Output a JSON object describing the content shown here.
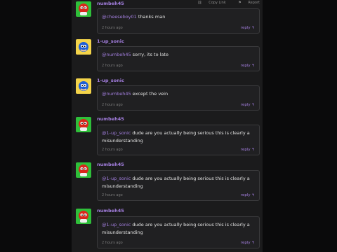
{
  "header_actions": {
    "copy_link": "Copy Link",
    "report": "Report"
  },
  "comments": [
    {
      "username": "numbeh45",
      "mention": "@cheeseboy01",
      "text": "thanks man",
      "time": "2 hours ago",
      "reply": "reply"
    },
    {
      "username": "1-up_sonic",
      "mention": "@numbeh45",
      "text": "sorry, its to late",
      "time": "2 hours ago",
      "reply": "reply"
    },
    {
      "username": "1-up_sonic",
      "mention": "@numbeh45",
      "text": "except the vein",
      "time": "2 hours ago",
      "reply": "reply"
    },
    {
      "username": "numbeh45",
      "mention": "@1-up_sonic",
      "text": "dude are you actually being serious this is clearly a misunderstanding",
      "time": "2 hours ago",
      "reply": "reply"
    },
    {
      "username": "numbeh45",
      "mention": "@1-up_sonic",
      "text": "dude are you actually being serious this is clearly a misunderstanding",
      "time": "2 hours ago",
      "reply": "reply"
    },
    {
      "username": "numbeh45",
      "mention": "@1-up_sonic",
      "text": "dude are you actually being serious this is clearly a misunderstanding",
      "time": "2 hours ago",
      "reply": "reply"
    }
  ]
}
